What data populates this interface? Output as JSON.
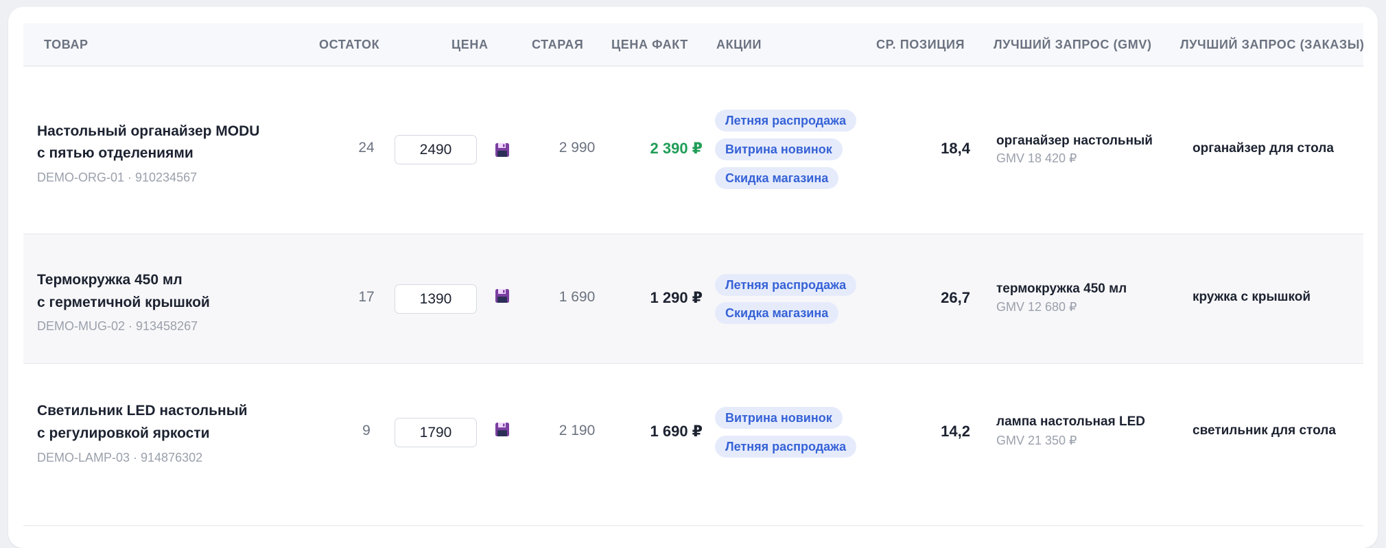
{
  "headers": {
    "product": "ТОВАР",
    "stock": "ОСТАТОК",
    "price": "ЦЕНА",
    "old_price": "СТАРАЯ",
    "fact_price": "ЦЕНА ФАКТ",
    "promos": "АКЦИИ",
    "avg_position": "СР. ПОЗИЦИЯ",
    "best_query_gmv": "ЛУЧШИЙ ЗАПРОС (GMV)",
    "best_query_orders": "ЛУЧШИЙ ЗАПРОС (ЗАКАЗЫ)"
  },
  "icons": {
    "save": "floppy-disk-save-icon"
  },
  "colors": {
    "accent_blue": "#3562d6",
    "badge_bg": "#e6ebfb",
    "fact_discount_green": "#1f9d57",
    "save_icon_purple": "#7b3fa0"
  },
  "rows": [
    {
      "name_line1": "Настольный органайзер MODU",
      "name_line2": "с пятью отделениями",
      "sku": "DEMO-ORG-01 · 910234567",
      "stock": "24",
      "price_input": "2490",
      "old_price": "2 990",
      "fact_price": "2 390 ₽",
      "fact_price_highlight": true,
      "promos": [
        "Летняя распродажа",
        "Витрина новинок",
        "Скидка магазина"
      ],
      "avg_position": "18,4",
      "best_query_gmv": "органайзер настольный",
      "best_query_gmv_value": "GMV 18 420 ₽",
      "best_query_orders": "органайзер для стола"
    },
    {
      "name_line1": "Термокружка 450 мл",
      "name_line2": "с герметичной крышкой",
      "sku": "DEMO-MUG-02 · 913458267",
      "stock": "17",
      "price_input": "1390",
      "old_price": "1 690",
      "fact_price": "1 290 ₽",
      "fact_price_highlight": false,
      "promos": [
        "Летняя распродажа",
        "Скидка магазина"
      ],
      "avg_position": "26,7",
      "best_query_gmv": "термокружка 450 мл",
      "best_query_gmv_value": "GMV 12 680 ₽",
      "best_query_orders": "кружка с крышкой"
    },
    {
      "name_line1": "Светильник LED настольный",
      "name_line2": "с регулировкой яркости",
      "sku": "DEMO-LAMP-03 · 914876302",
      "stock": "9",
      "price_input": "1790",
      "old_price": "2 190",
      "fact_price": "1 690 ₽",
      "fact_price_highlight": false,
      "promos": [
        "Витрина новинок",
        "Летняя распродажа"
      ],
      "avg_position": "14,2",
      "best_query_gmv": "лампа настольная LED",
      "best_query_gmv_value": "GMV 21 350 ₽",
      "best_query_orders": "светильник для стола"
    }
  ]
}
